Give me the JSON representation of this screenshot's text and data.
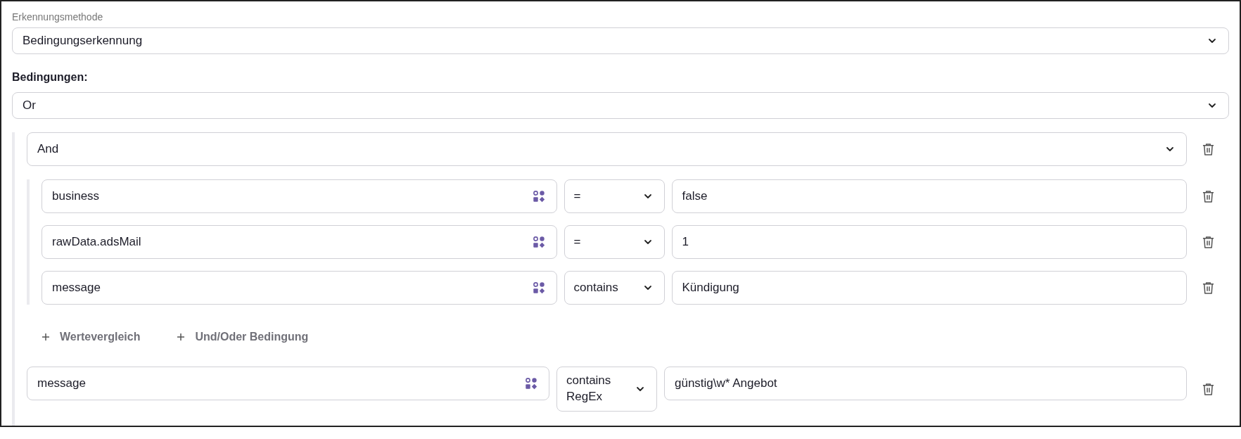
{
  "detection_method": {
    "label": "Erkennungsmethode",
    "value": "Bedingungserkennung"
  },
  "conditions": {
    "label": "Bedingungen:",
    "operator": "Or",
    "children": [
      {
        "kind": "group",
        "operator": "And",
        "children": [
          {
            "kind": "comparison",
            "field": "business",
            "operator": "=",
            "value": "false"
          },
          {
            "kind": "comparison",
            "field": "rawData.adsMail",
            "operator": "=",
            "value": "1"
          },
          {
            "kind": "comparison",
            "field": "message",
            "operator": "contains",
            "value": "Kündigung"
          }
        ],
        "actions": [
          "Wertevergleich",
          "Und/Oder Bedingung"
        ]
      },
      {
        "kind": "comparison",
        "field": "message",
        "operator": "contains RegEx",
        "value": "günstig\\w* Angebot"
      }
    ]
  }
}
